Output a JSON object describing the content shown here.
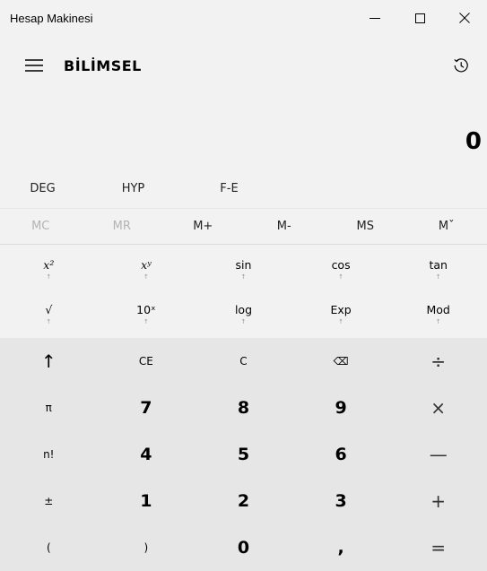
{
  "window": {
    "title": "Hesap Makinesi",
    "controls": [
      "minimize-icon",
      "maximize-icon",
      "close-icon"
    ]
  },
  "header": {
    "mode": "BİLİMSEL",
    "menu_icon": "hamburger-menu-icon",
    "history_icon": "history-icon"
  },
  "display": {
    "value": "0"
  },
  "modes": [
    "DEG",
    "HYP",
    "F-E"
  ],
  "memory": [
    {
      "label": "MC",
      "enabled": false
    },
    {
      "label": "MR",
      "enabled": false
    },
    {
      "label": "M+",
      "enabled": true
    },
    {
      "label": "M-",
      "enabled": true
    },
    {
      "label": "MS",
      "enabled": true
    },
    {
      "label": "Mˇ",
      "enabled": true
    }
  ],
  "functions_row1": [
    {
      "label": "x²",
      "sub": "↑"
    },
    {
      "label": "xʸ",
      "sub": "↑"
    },
    {
      "label": "sin",
      "sub": "↑"
    },
    {
      "label": "cos",
      "sub": "↑"
    },
    {
      "label": "tan",
      "sub": "↑"
    }
  ],
  "functions_row2": [
    {
      "label": "√",
      "sub": "↑"
    },
    {
      "label": "10ˣ",
      "sub": "↑"
    },
    {
      "label": "log",
      "sub": "↑"
    },
    {
      "label": "Exp",
      "sub": "↑"
    },
    {
      "label": "Mod",
      "sub": "↑"
    }
  ],
  "keypad": [
    [
      "↑",
      "CE",
      "C",
      "⌫",
      "÷"
    ],
    [
      "π",
      "7",
      "8",
      "9",
      "×"
    ],
    [
      "n!",
      "4",
      "5",
      "6",
      "—"
    ],
    [
      "±",
      "1",
      "2",
      "3",
      "+"
    ],
    [
      "(",
      ")",
      "0",
      ",",
      "="
    ]
  ]
}
